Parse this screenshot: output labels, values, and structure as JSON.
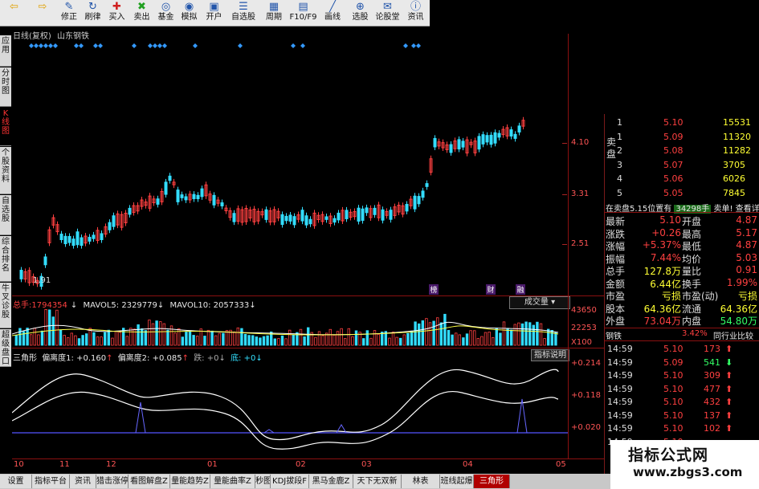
{
  "toolbar": {
    "buttons": [
      {
        "label": "",
        "icon": "back-arrow-icon"
      },
      {
        "label": "",
        "icon": "forward-arrow-icon"
      },
      {
        "label": "修正",
        "icon": "edit-icon"
      },
      {
        "label": "刷律",
        "icon": "refresh-icon"
      },
      {
        "label": "买入",
        "icon": "buy-icon"
      },
      {
        "label": "卖出",
        "icon": "sell-icon"
      },
      {
        "label": "基金",
        "icon": "fund-icon"
      },
      {
        "label": "模拟",
        "icon": "simulate-icon"
      },
      {
        "label": "开户",
        "icon": "open-account-icon"
      },
      {
        "label": "自选股",
        "icon": "watchlist-icon"
      },
      {
        "label": "周期",
        "icon": "period-icon"
      },
      {
        "label": "F10/F9",
        "icon": "f10-icon"
      },
      {
        "label": "画线",
        "icon": "draw-line-icon"
      },
      {
        "label": "选股",
        "icon": "stock-picker-icon"
      },
      {
        "label": "论股堂",
        "icon": "forum-icon"
      },
      {
        "label": "资讯",
        "icon": "news-icon"
      }
    ]
  },
  "left_tabs": [
    "应用",
    "分时图",
    "K线图",
    "个股资料",
    "自选股",
    "综合排名",
    "牛叉诊股",
    "超级盘口"
  ],
  "chart_header": {
    "mode": "日线(复权)",
    "name": "山东钢铁"
  },
  "price_axis": [
    "4.10",
    "3.31",
    "2.51"
  ],
  "price_low_label": "1.91",
  "event_markers": [
    "榜",
    "财",
    "融"
  ],
  "volume_header": {
    "total_label": "总手:",
    "total_value": "1794354",
    "ma5": "MAVOL5: 2329779",
    "ma10": "MAVOL10: 2057333",
    "button": "成交量"
  },
  "volume_axis": [
    "43650",
    "22253",
    "X100"
  ],
  "indicator_header": {
    "name": "三角形",
    "p1": "偏离度1: +0.160",
    "p2": "偏离度2: +0.085",
    "p3": "跌: +0",
    "p4": "底: +0",
    "help": "指标说明"
  },
  "indicator_axis": [
    "+0.214",
    "+0.118",
    "+0.020"
  ],
  "date_axis": [
    "10",
    "11",
    "12",
    "01",
    "02",
    "03",
    "04",
    "05"
  ],
  "bottom_tabs": [
    "设置",
    "指标平台",
    "资讯",
    "猎击涨停",
    "看图解盘Z",
    "量能趋势Z",
    "量能曲率Z",
    "秒图买点",
    "KDJ拔段F",
    "黑马金鹿Z",
    "天下无双新",
    "林表",
    "班线起爆",
    "三角形"
  ],
  "order_book": {
    "sell_label": "卖盘",
    "rows": [
      {
        "level": "1",
        "price": "5.10",
        "vol": "15531"
      },
      {
        "level": "1",
        "price": "5.09",
        "vol": "11320"
      },
      {
        "level": "2",
        "price": "5.08",
        "vol": "11282"
      },
      {
        "level": "3",
        "price": "5.07",
        "vol": "3705"
      },
      {
        "level": "4",
        "price": "5.06",
        "vol": "6026"
      },
      {
        "level": "5",
        "price": "5.05",
        "vol": "7845"
      }
    ],
    "note_left": "在卖盘5.15位置有",
    "note_mid": "34298手",
    "note_right": "卖单! 查看详细"
  },
  "quote": [
    {
      "l1": "最新",
      "v1": "5.10",
      "l2": "开盘",
      "v2": "4.87"
    },
    {
      "l1": "涨跌",
      "v1": "+0.26",
      "l2": "最高",
      "v2": "5.17"
    },
    {
      "l1": "涨幅",
      "v1": "+5.37%",
      "l2": "最低",
      "v2": "4.87"
    },
    {
      "l1": "振幅",
      "v1": "7.44%",
      "l2": "均价",
      "v2": "5.03"
    },
    {
      "l1": "总手",
      "v1": "127.8万",
      "l2": "量比",
      "v2": "0.91"
    },
    {
      "l1": "金额",
      "v1": "6.44亿",
      "l2": "换手",
      "v2": "1.99%"
    },
    {
      "l1": "市盈",
      "v1": "亏损",
      "l2": "市盈(动)",
      "v2": "亏损"
    },
    {
      "l1": "股本",
      "v1": "64.36亿",
      "l2": "流通",
      "v2": "64.36亿"
    },
    {
      "l1": "外盘",
      "v1": "73.04万",
      "l2": "内盘",
      "v2": "54.80万"
    }
  ],
  "sector": {
    "name": "钢铁",
    "pct": "3.42%",
    "link": "同行业比较"
  },
  "ticks": [
    {
      "time": "14:59",
      "price": "5.10",
      "vol": "173"
    },
    {
      "time": "14:59",
      "price": "5.09",
      "vol": "541"
    },
    {
      "time": "14:59",
      "price": "5.10",
      "vol": "309"
    },
    {
      "time": "14:59",
      "price": "5.10",
      "vol": "477"
    },
    {
      "time": "14:59",
      "price": "5.10",
      "vol": "432"
    },
    {
      "time": "14:59",
      "price": "5.10",
      "vol": "137"
    },
    {
      "time": "14:59",
      "price": "5.10",
      "vol": "102"
    },
    {
      "time": "14:59",
      "price": "5.10",
      "vol": ""
    }
  ],
  "watermark": {
    "title": "指标公式网",
    "url": "www.zbgs3.com"
  }
}
